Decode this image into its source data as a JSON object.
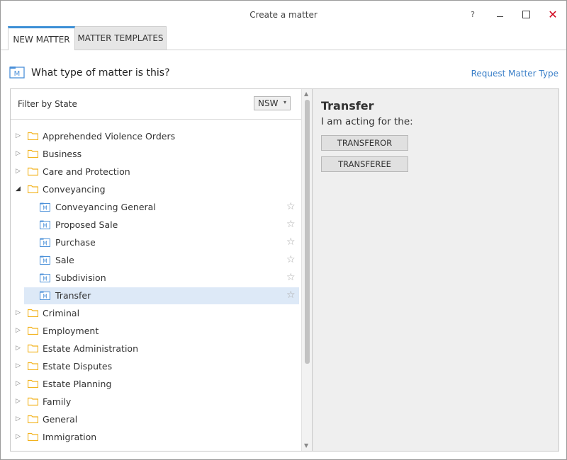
{
  "window": {
    "title": "Create a matter",
    "help": "?",
    "close": "✕"
  },
  "tabs": [
    {
      "label": "NEW MATTER"
    },
    {
      "label": "MATTER TEMPLATES"
    }
  ],
  "header": {
    "question": "What type of matter is this?",
    "request_link": "Request Matter Type"
  },
  "filter": {
    "label": "Filter by State",
    "state": "NSW"
  },
  "tree": {
    "top": [
      {
        "label": "Apprehended Violence Orders"
      },
      {
        "label": "Business"
      },
      {
        "label": "Care and Protection"
      },
      {
        "label": "Conveyancing"
      }
    ],
    "children": [
      {
        "label": "Conveyancing General"
      },
      {
        "label": "Proposed Sale"
      },
      {
        "label": "Purchase"
      },
      {
        "label": "Sale"
      },
      {
        "label": "Subdivision"
      },
      {
        "label": "Transfer"
      }
    ],
    "rest": [
      {
        "label": "Criminal"
      },
      {
        "label": "Employment"
      },
      {
        "label": "Estate Administration"
      },
      {
        "label": "Estate Disputes"
      },
      {
        "label": "Estate Planning"
      },
      {
        "label": "Family"
      },
      {
        "label": "General"
      },
      {
        "label": "Immigration"
      }
    ]
  },
  "detail": {
    "title": "Transfer",
    "subtitle": "I am acting for the:",
    "buttons": [
      {
        "label": "TRANSFEROR"
      },
      {
        "label": "TRANSFEREE"
      }
    ]
  },
  "colors": {
    "accent": "#3c8fd6",
    "folder": "#f2b21c",
    "selected": "#dde9f7",
    "close": "#d0021b"
  }
}
